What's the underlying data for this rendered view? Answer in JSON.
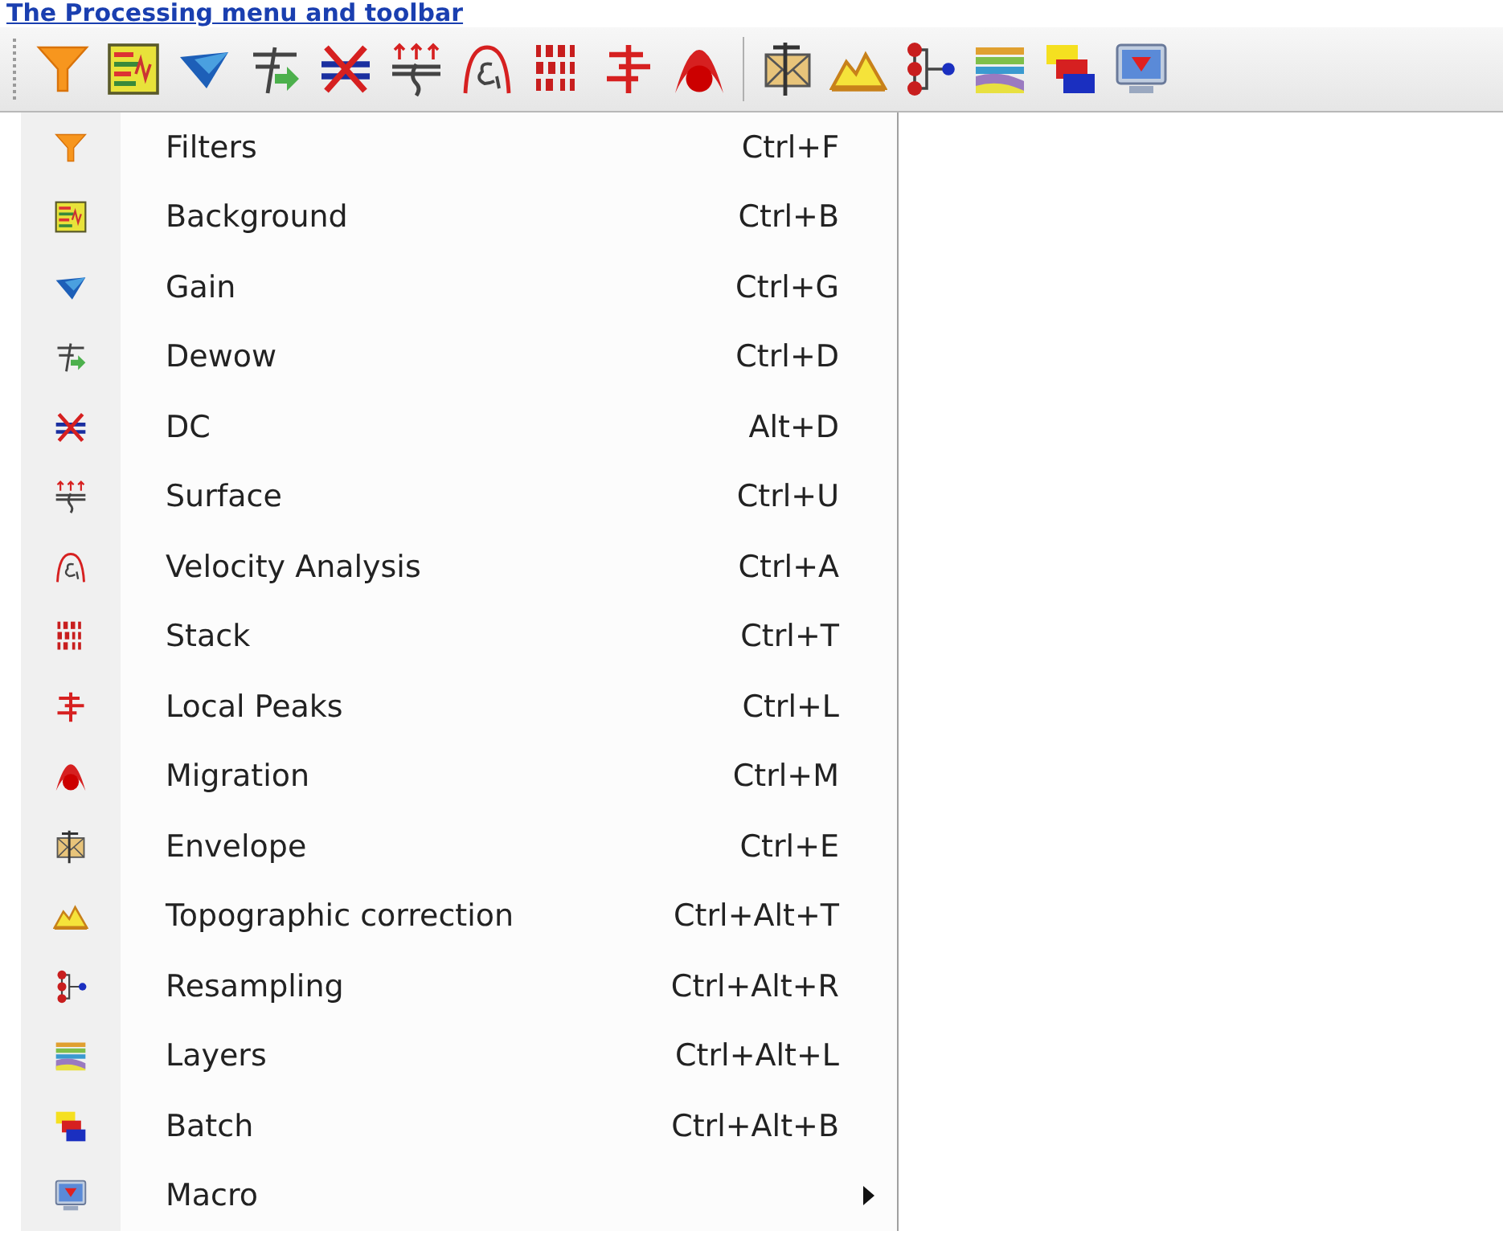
{
  "heading": "The Processing menu and toolbar",
  "menu": {
    "items": [
      {
        "label": "Filters",
        "shortcut": "Ctrl+F",
        "submenu": false
      },
      {
        "label": "Background",
        "shortcut": "Ctrl+B",
        "submenu": false
      },
      {
        "label": "Gain",
        "shortcut": "Ctrl+G",
        "submenu": false
      },
      {
        "label": "Dewow",
        "shortcut": "Ctrl+D",
        "submenu": false
      },
      {
        "label": "DC",
        "shortcut": "Alt+D",
        "submenu": false
      },
      {
        "label": "Surface",
        "shortcut": "Ctrl+U",
        "submenu": false
      },
      {
        "label": "Velocity Analysis",
        "shortcut": "Ctrl+A",
        "submenu": false
      },
      {
        "label": "Stack",
        "shortcut": "Ctrl+T",
        "submenu": false
      },
      {
        "label": "Local Peaks",
        "shortcut": "Ctrl+L",
        "submenu": false
      },
      {
        "label": "Migration",
        "shortcut": "Ctrl+M",
        "submenu": false
      },
      {
        "label": "Envelope",
        "shortcut": "Ctrl+E",
        "submenu": false
      },
      {
        "label": "Topographic correction",
        "shortcut": "Ctrl+Alt+T",
        "submenu": false
      },
      {
        "label": "Resampling",
        "shortcut": "Ctrl+Alt+R",
        "submenu": false
      },
      {
        "label": "Layers",
        "shortcut": "Ctrl+Alt+L",
        "submenu": false
      },
      {
        "label": "Batch",
        "shortcut": "Ctrl+Alt+B",
        "submenu": false
      },
      {
        "label": "Macro",
        "submenu": true
      }
    ]
  }
}
